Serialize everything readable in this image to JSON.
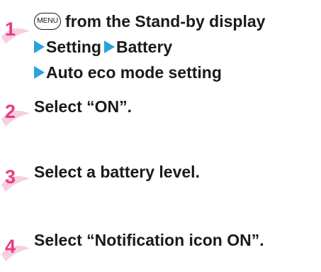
{
  "steps": [
    {
      "number": "1",
      "menu_key": "MENU",
      "line1": "from the Stand-by display",
      "path": [
        "Setting",
        "Battery",
        "Auto eco mode setting"
      ]
    },
    {
      "number": "2",
      "text": "Select “ON”."
    },
    {
      "number": "3",
      "text": "Select a battery level."
    },
    {
      "number": "4",
      "text": "Select “Notification icon ON”."
    }
  ],
  "colors": {
    "step_number": "#e83a84",
    "step_swoosh": "#f6cfe1",
    "arrow": "#2aa3dc",
    "text": "#1a1a1a"
  }
}
